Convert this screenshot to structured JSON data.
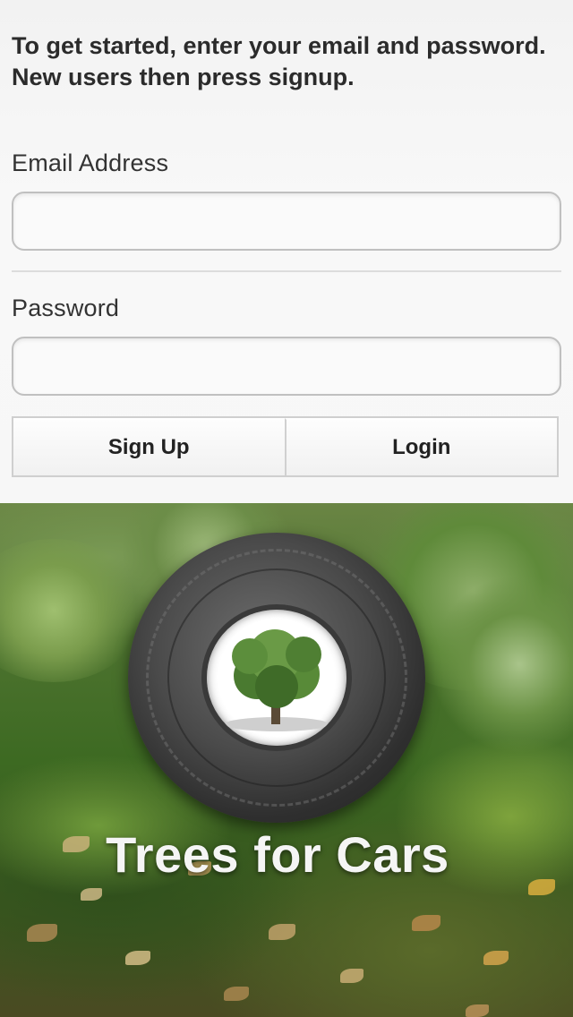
{
  "intro_text": "To get started, enter your email and password. New users then press signup.",
  "fields": {
    "email": {
      "label": "Email Address",
      "value": "",
      "placeholder": ""
    },
    "password": {
      "label": "Password",
      "value": "",
      "placeholder": ""
    }
  },
  "buttons": {
    "signup": "Sign Up",
    "login": "Login"
  },
  "hero": {
    "logo_icon": "tire-with-tree-icon",
    "app_title": "Trees for Cars"
  },
  "colors": {
    "panel_background": "#f6f6f6",
    "title_text": "#f5f5f5",
    "tire": "#3a3a3a",
    "tree": "#4f7f33"
  }
}
